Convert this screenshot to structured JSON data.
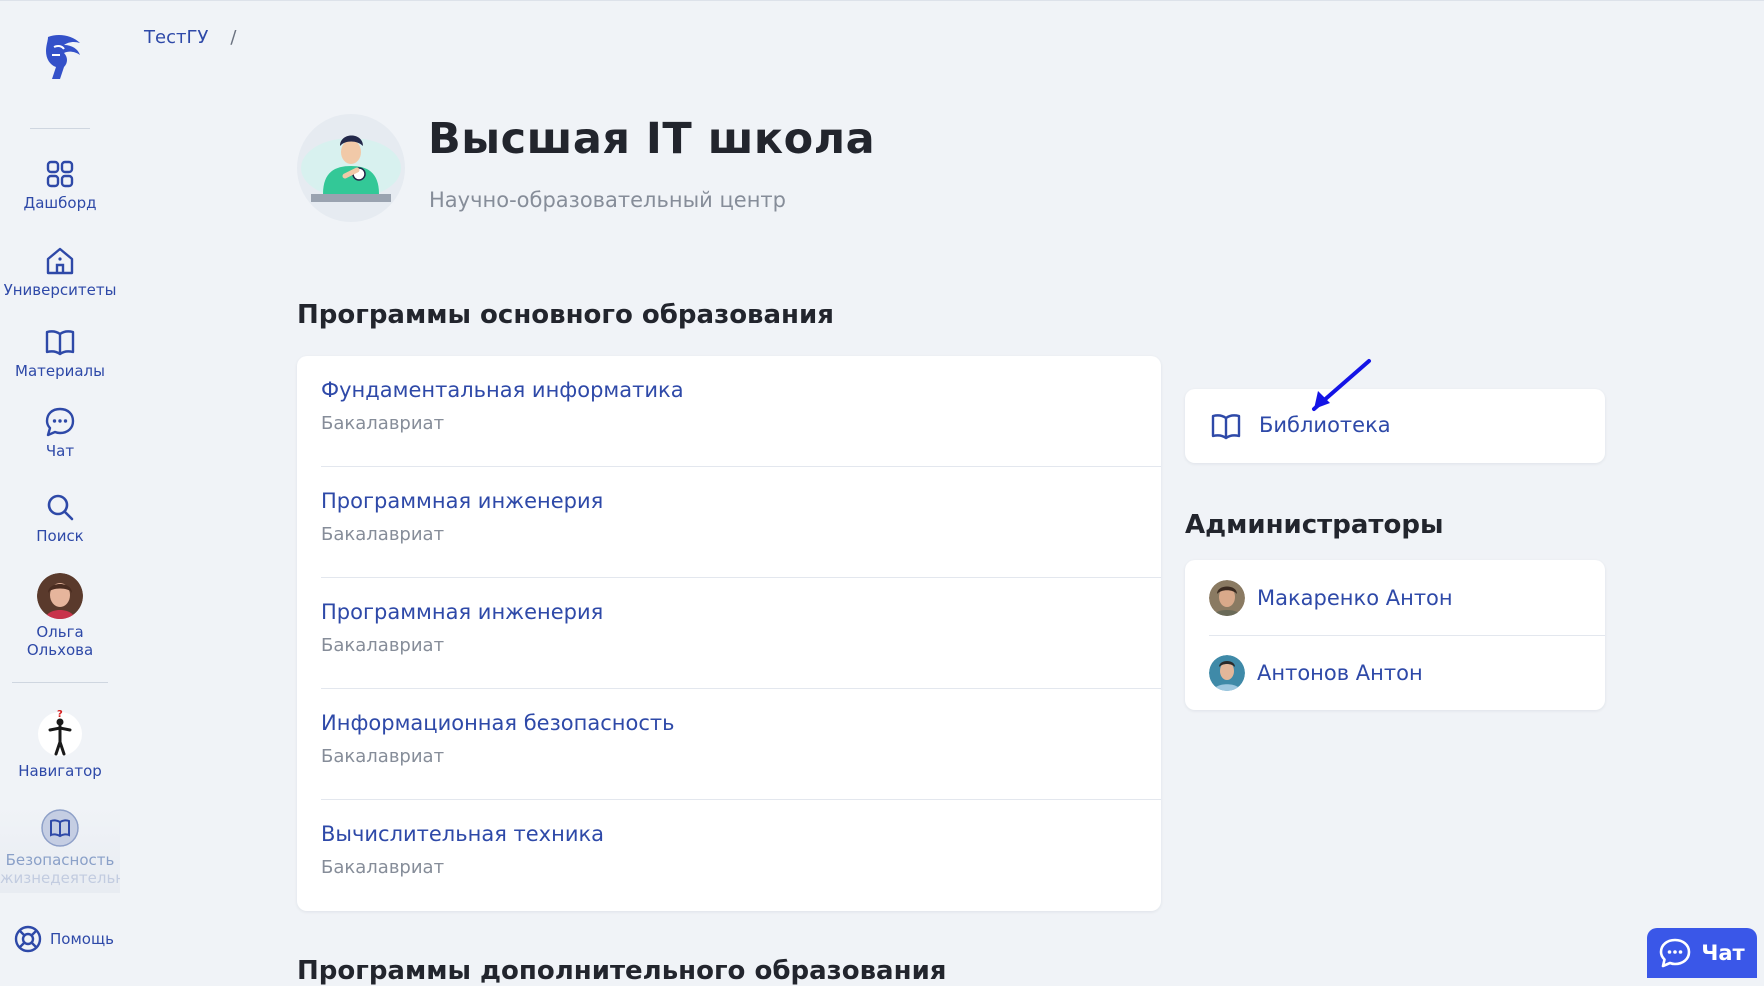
{
  "sidebar": {
    "items": [
      {
        "label": "Дашборд",
        "icon": "dashboard-icon"
      },
      {
        "label": "Университеты",
        "icon": "university-icon"
      },
      {
        "label": "Материалы",
        "icon": "book-icon"
      },
      {
        "label": "Чат",
        "icon": "chat-icon"
      },
      {
        "label": "Поиск",
        "icon": "search-icon"
      }
    ],
    "user": {
      "name_line1": "Ольга",
      "name_line2": "Ольхова"
    },
    "navigator_label": "Навигатор",
    "course_label_line1": "Безопасность",
    "course_label_line2": "жизнедеятельн",
    "help_label": "Помощь"
  },
  "breadcrumb": {
    "root": "ТестГУ",
    "separator": "/"
  },
  "header": {
    "title": "Высшая IT школа",
    "subtitle": "Научно-образовательный центр"
  },
  "programs": {
    "title": "Программы основного образования",
    "items": [
      {
        "name": "Фундаментальная информатика",
        "level": "Бакалавриат"
      },
      {
        "name": "Программная инженерия",
        "level": "Бакалавриат"
      },
      {
        "name": "Программная инженерия",
        "level": "Бакалавриат"
      },
      {
        "name": "Информационная безопасность",
        "level": "Бакалавриат"
      },
      {
        "name": "Вычислительная техника",
        "level": "Бакалавриат"
      }
    ]
  },
  "additional_programs_title": "Программы дополнительного образования",
  "library": {
    "label": "Библиотека"
  },
  "admins": {
    "title": "Администраторы",
    "items": [
      {
        "name": "Макаренко Антон"
      },
      {
        "name": "Антонов Антон"
      }
    ]
  },
  "chat_button": {
    "label": "Чат"
  },
  "colors": {
    "accent": "#2e49a8",
    "chat": "#3a57e8",
    "background": "#f0f3f7"
  }
}
